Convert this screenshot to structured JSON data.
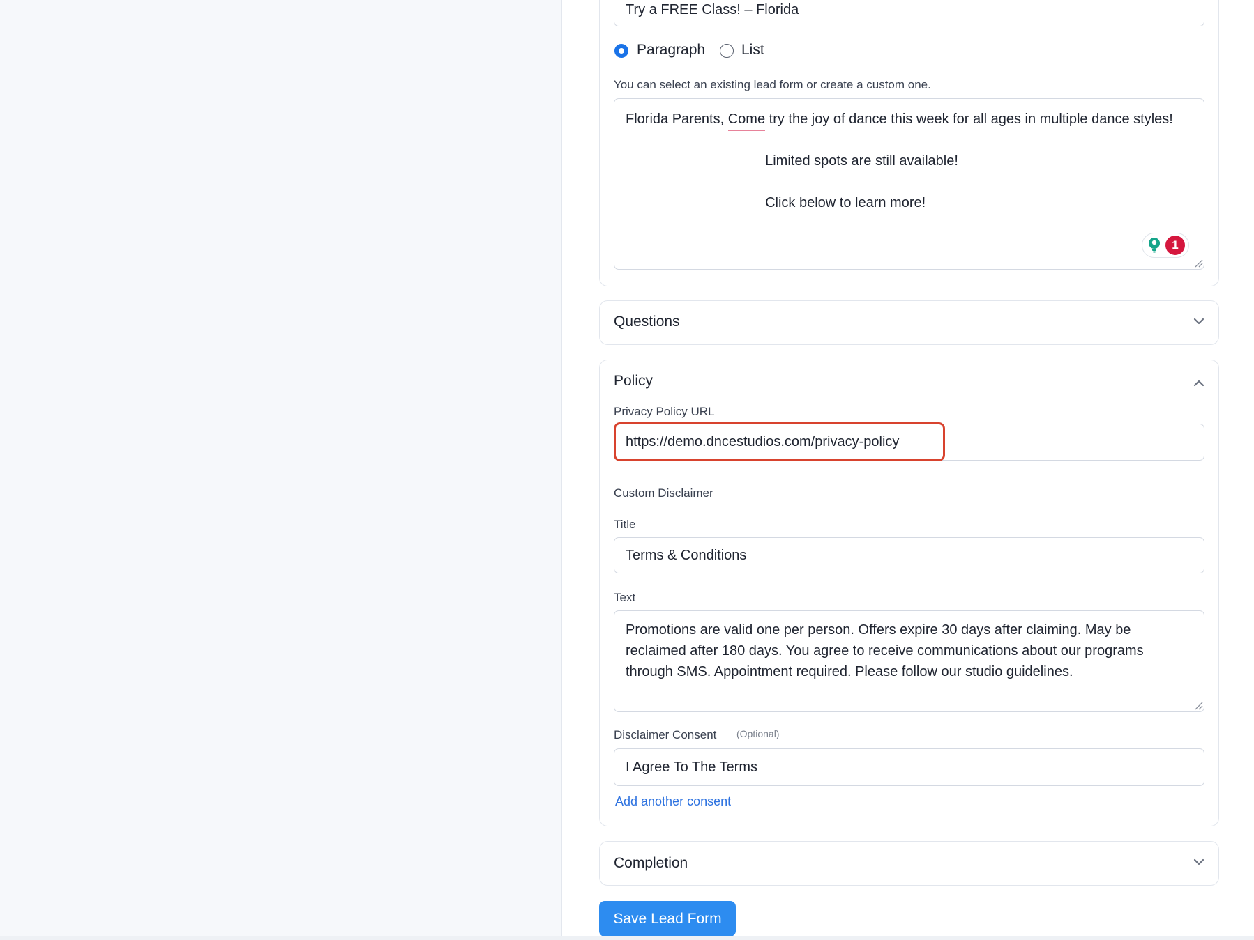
{
  "headline": {
    "value": "Try a FREE Class! – Florida"
  },
  "description_format": {
    "options": [
      {
        "label": "Paragraph",
        "selected": true
      },
      {
        "label": "List",
        "selected": false
      }
    ]
  },
  "description": {
    "helper": "You can select an existing lead form or create a custom one.",
    "text_before": "Florida Parents, ",
    "text_misspelled": "Come",
    "text_after": " try the joy of dance this week for all ages in multiple dance styles!\n\nLimited spots are still available!\n\nClick below to learn more!",
    "grammarly_count": "1"
  },
  "sections": {
    "questions": {
      "title": "Questions",
      "expanded": false
    },
    "policy": {
      "title": "Policy",
      "expanded": true
    },
    "completion": {
      "title": "Completion",
      "expanded": false
    }
  },
  "policy": {
    "privacy_url_label": "Privacy Policy URL",
    "privacy_url_value": "https://demo.dncestudios.com/privacy-policy",
    "custom_disclaimer_label": "Custom Disclaimer",
    "title_label": "Title",
    "title_value": "Terms & Conditions",
    "text_label": "Text",
    "text_value": "Promotions are valid one per person. Offers expire 30 days after claiming. May be reclaimed after 180 days. You agree to receive communications about our programs through SMS. Appointment required. Please follow our studio guidelines.",
    "consent_label": "Disclaimer Consent",
    "consent_optional": "(Optional)",
    "consent_value": "I Agree To The Terms",
    "add_consent_link": "Add another consent"
  },
  "save_button": {
    "label": "Save Lead Form"
  },
  "colors": {
    "primary": "#2d8cf0",
    "highlight": "#d8432e",
    "link": "#2d72e0",
    "grammarly_green": "#15a58a",
    "grammarly_red": "#d5173e"
  }
}
